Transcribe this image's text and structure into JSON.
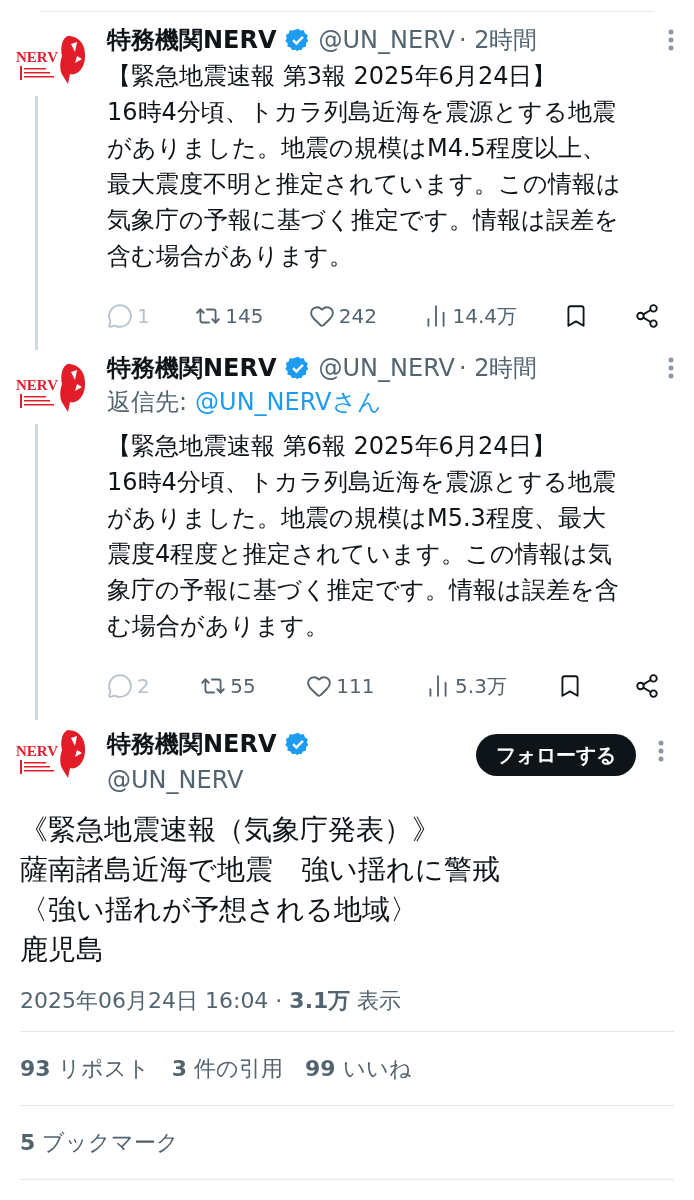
{
  "thread": [
    {
      "logo_text": "NERV",
      "name": "特務機関NERV",
      "handle": "@UN_NERV",
      "time": "· 2時間",
      "lines": [
        "【緊急地震速報 第3報 2025年6月24日】",
        "16時4分頃、トカラ列島近海を震源とする地震",
        "がありました。地震の規模はM4.5程度以上、",
        "最大震度不明と推定されています。この情報は",
        "気象庁の予報に基づく推定です。情報は誤差を",
        "含む場合があります。"
      ],
      "actions": [
        {
          "kind": "reply",
          "count": "1"
        },
        {
          "kind": "repost",
          "count": "145"
        },
        {
          "kind": "like",
          "count": "242"
        },
        {
          "kind": "views",
          "count": "14.4万"
        },
        {
          "kind": "bookmark"
        },
        {
          "kind": "share"
        }
      ]
    },
    {
      "logo_text": "NERV",
      "name": "特務機関NERV",
      "handle": "@UN_NERV",
      "time": "· 2時間",
      "reply_label": "返信先:",
      "reply_to": "@UN_NERVさん",
      "lines": [
        "【緊急地震速報 第6報 2025年6月24日】",
        "16時4分頃、トカラ列島近海を震源とする地震",
        "がありました。地震の規模はM5.3程度、最大",
        "震度4程度と推定されています。この情報は気",
        "象庁の予報に基づく推定です。情報は誤差を含",
        "む場合があります。"
      ],
      "actions": [
        {
          "kind": "reply",
          "count": "2"
        },
        {
          "kind": "repost",
          "count": "55"
        },
        {
          "kind": "like",
          "count": "111"
        },
        {
          "kind": "views",
          "count": "5.3万"
        },
        {
          "kind": "bookmark"
        },
        {
          "kind": "share"
        }
      ]
    }
  ],
  "main": {
    "logo_text": "NERV",
    "name": "特務機関NERV",
    "handle": "@UN_NERV",
    "follow_button": "フォローする",
    "lines": [
      "《緊急地震速報（気象庁発表）》",
      "薩南諸島近海で地震　強い揺れに警戒",
      "〈強い揺れが予想される地域〉",
      "鹿児島"
    ],
    "meta": "2025年06月24日 16:04 · **3.1万** 表示",
    "stats": [
      "**93** リポスト",
      "**3** 件の引用",
      "**99** いいね"
    ],
    "bookmarks": "**5** ブックマーク"
  }
}
